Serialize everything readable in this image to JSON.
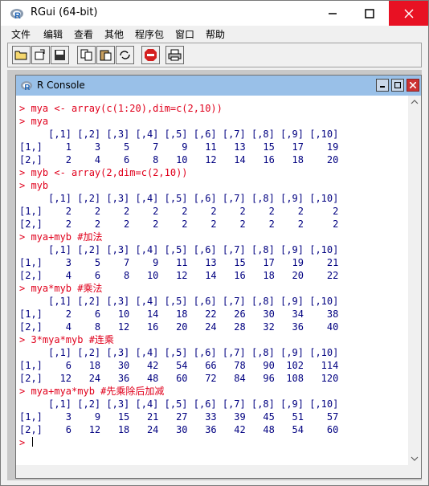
{
  "window": {
    "title": "RGui (64-bit)"
  },
  "menu": [
    "文件",
    "编辑",
    "查看",
    "其他",
    "程序包",
    "窗口",
    "帮助"
  ],
  "toolbar": [
    "open-script",
    "load-workspace",
    "save-workspace",
    "copy",
    "paste",
    "copy-paste",
    "stop",
    "print"
  ],
  "console": {
    "title": "R Console",
    "lines": [
      {
        "t": "cmd",
        "s": "> mya <- array(c(1:20),dim=c(2,10))"
      },
      {
        "t": "cmd",
        "s": "> mya"
      },
      {
        "t": "out",
        "s": "     [,1] [,2] [,3] [,4] [,5] [,6] [,7] [,8] [,9] [,10]"
      },
      {
        "t": "out",
        "s": "[1,]    1    3    5    7    9   11   13   15   17    19"
      },
      {
        "t": "out",
        "s": "[2,]    2    4    6    8   10   12   14   16   18    20"
      },
      {
        "t": "cmd",
        "s": "> myb <- array(2,dim=c(2,10))"
      },
      {
        "t": "cmd",
        "s": "> myb"
      },
      {
        "t": "out",
        "s": "     [,1] [,2] [,3] [,4] [,5] [,6] [,7] [,8] [,9] [,10]"
      },
      {
        "t": "out",
        "s": "[1,]    2    2    2    2    2    2    2    2    2     2"
      },
      {
        "t": "out",
        "s": "[2,]    2    2    2    2    2    2    2    2    2     2"
      },
      {
        "t": "cmd",
        "s": "> mya+myb #加法"
      },
      {
        "t": "out",
        "s": "     [,1] [,2] [,3] [,4] [,5] [,6] [,7] [,8] [,9] [,10]"
      },
      {
        "t": "out",
        "s": "[1,]    3    5    7    9   11   13   15   17   19    21"
      },
      {
        "t": "out",
        "s": "[2,]    4    6    8   10   12   14   16   18   20    22"
      },
      {
        "t": "cmd",
        "s": "> mya*myb #乘法"
      },
      {
        "t": "out",
        "s": "     [,1] [,2] [,3] [,4] [,5] [,6] [,7] [,8] [,9] [,10]"
      },
      {
        "t": "out",
        "s": "[1,]    2    6   10   14   18   22   26   30   34    38"
      },
      {
        "t": "out",
        "s": "[2,]    4    8   12   16   20   24   28   32   36    40"
      },
      {
        "t": "cmd",
        "s": "> 3*mya*myb #连乘"
      },
      {
        "t": "out",
        "s": "     [,1] [,2] [,3] [,4] [,5] [,6] [,7] [,8] [,9] [,10]"
      },
      {
        "t": "out",
        "s": "[1,]    6   18   30   42   54   66   78   90  102   114"
      },
      {
        "t": "out",
        "s": "[2,]   12   24   36   48   60   72   84   96  108   120"
      },
      {
        "t": "cmd",
        "s": "> mya+mya*myb #先乘除后加减"
      },
      {
        "t": "out",
        "s": "     [,1] [,2] [,3] [,4] [,5] [,6] [,7] [,8] [,9] [,10]"
      },
      {
        "t": "out",
        "s": "[1,]    3    9   15   21   27   33   39   45   51    57"
      },
      {
        "t": "out",
        "s": "[2,]    6   12   18   24   30   36   42   48   54    60"
      }
    ],
    "prompt": ">"
  }
}
